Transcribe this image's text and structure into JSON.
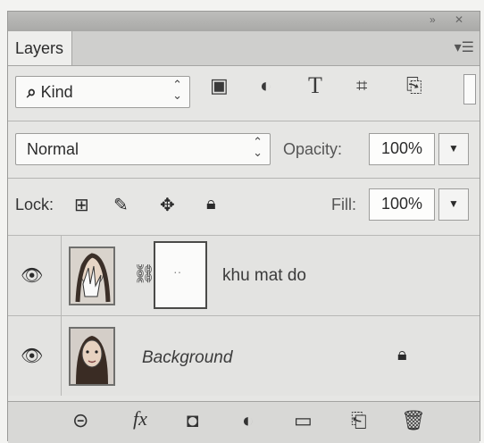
{
  "panel": {
    "tab_label": "Layers",
    "menu_icon": "panel-menu-icon"
  },
  "filter": {
    "kind_label": "Kind",
    "icons": [
      "pixel-filter-icon",
      "adjustment-filter-icon",
      "type-filter-icon",
      "shape-filter-icon",
      "smart-object-filter-icon"
    ]
  },
  "blend": {
    "mode": "Normal",
    "opacity_label": "Opacity:",
    "opacity_value": "100%"
  },
  "lock": {
    "label": "Lock:",
    "icons": [
      "lock-transparent-icon",
      "lock-image-icon",
      "lock-position-icon",
      "lock-all-icon"
    ],
    "fill_label": "Fill:",
    "fill_value": "100%"
  },
  "layers": [
    {
      "name": "khu mat do",
      "visible": true,
      "has_mask": true,
      "locked": false
    },
    {
      "name": "Background",
      "visible": true,
      "has_mask": false,
      "locked": true
    }
  ],
  "bottom_icons": [
    "link-layers-icon",
    "layer-style-icon",
    "add-mask-icon",
    "adjustment-layer-icon",
    "new-group-icon",
    "new-layer-icon",
    "delete-layer-icon"
  ]
}
